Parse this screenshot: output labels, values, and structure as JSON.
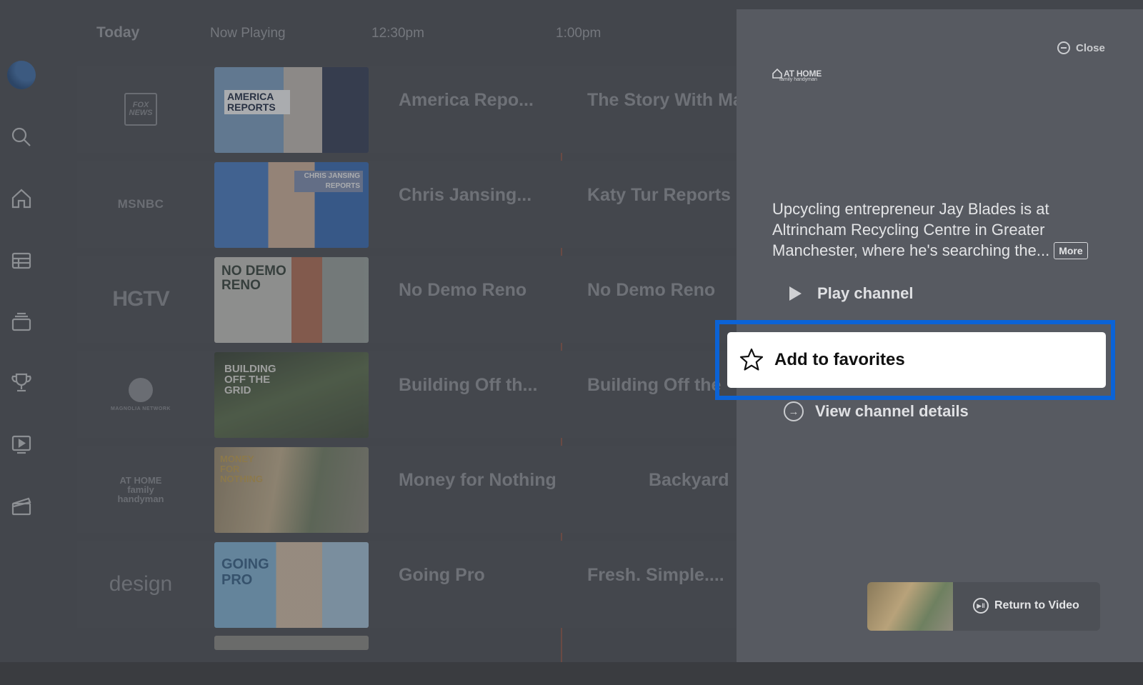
{
  "guide": {
    "times": [
      "Today",
      "Now Playing",
      "12:30pm",
      "1:00pm"
    ],
    "rows": [
      {
        "channel": "FOX NEWS",
        "now": "America Repo...",
        "next": "The Story With Ma",
        "thumb_text": "AMERICA REPORTS"
      },
      {
        "channel": "MSNBC",
        "now": "Chris Jansing...",
        "next": "Katy Tur Reports",
        "thumb_text": "CHRIS JANSING REPORTS"
      },
      {
        "channel": "HGTV",
        "now": "No Demo Reno",
        "next": "No Demo Reno",
        "thumb_text": "NO DEMO RENO"
      },
      {
        "channel": "MAGNOLIA NETWORK",
        "now": "Building Off th...",
        "next": "Building Off the",
        "thumb_text": "BUILDING OFF THE GRID"
      },
      {
        "channel": "AT HOME family handyman",
        "now": "Money for Nothing",
        "next": "Backyard",
        "thumb_text": "MONEY FOR NOTHING"
      },
      {
        "channel": "design",
        "now": "Going Pro",
        "next": "Fresh. Simple....",
        "thumb_text": "GOING PRO"
      }
    ]
  },
  "nav": {
    "icons": [
      "search-icon",
      "home-icon",
      "guide-icon",
      "live-tv-icon",
      "sports-trophy-icon",
      "on-demand-icon",
      "movies-icon"
    ]
  },
  "panel": {
    "close_label": "Close",
    "channel_logo": "AT HOME",
    "channel_logo_sub": "family handyman",
    "description": "Upcycling entrepreneur Jay Blades is at Altrincham Recycling Centre in Greater Manchester, where he's searching the...",
    "more_label": "More",
    "play_label": "Play channel",
    "favorite_label": "Add to favorites",
    "details_label": "View channel details",
    "return_label": "Return to Video"
  },
  "colors": {
    "focus": "#0b63d6",
    "panel_bg": "#575a61"
  }
}
